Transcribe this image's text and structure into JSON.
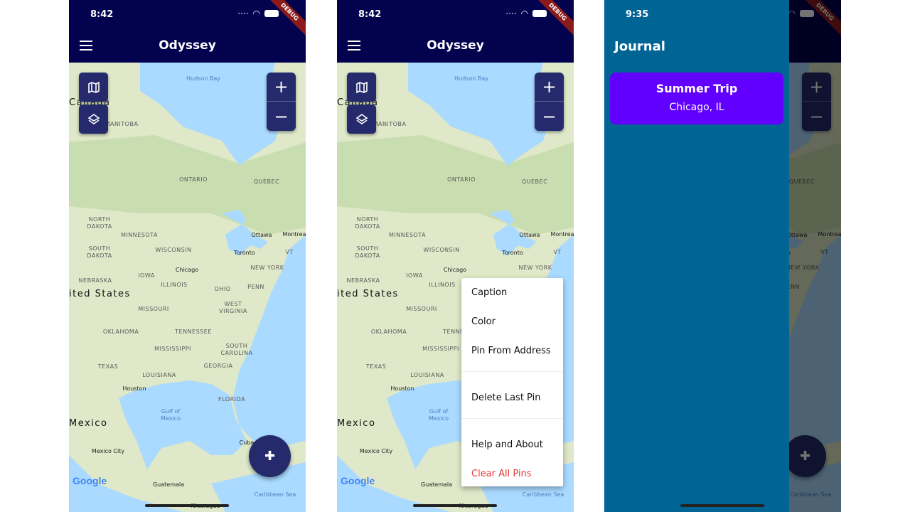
{
  "colors": {
    "appbar": "#02024f",
    "button": "#242a6b",
    "drawer": "#006494",
    "card": "#6200ff",
    "danger": "#e53935",
    "water": "#aadaff",
    "land": "#dfe8c8"
  },
  "screens": [
    {
      "time": "8:42",
      "title": "Odyssey",
      "debug": "DEBUG"
    },
    {
      "time": "8:42",
      "title": "Odyssey",
      "debug": "DEBUG"
    },
    {
      "time": "9:35",
      "debug": "DEBUG"
    }
  ],
  "icons": {
    "menu": "hamburger-icon",
    "map": "map-icon",
    "layers": "layers-icon",
    "zoom_in": "+",
    "zoom_out": "−",
    "pin": "📌"
  },
  "map": {
    "google_logo": "Google",
    "labels": [
      "Hudson Bay",
      "Canada",
      "MANITOBA",
      "ONTARIO",
      "QUEBEC",
      "NORTH\nDAKOTA",
      "MINNESOTA",
      "SOUTH\nDAKOTA",
      "WISCONSIN",
      "Ottawa",
      "Montrea",
      "Toronto",
      "VT",
      "NEBRASKA",
      "IOWA",
      "Chicago",
      "ILLINOIS",
      "OHIO",
      "NEW YORK",
      "PENN",
      "ited States",
      "MISSOURI",
      "WEST\nVIRGINIA",
      "OKLAHOMA",
      "TENNESSEE",
      "MISSISSIPPI",
      "SOUTH\nCAROLINA",
      "TEXAS",
      "GEORGIA",
      "LOUISIANA",
      "Houston",
      "FLORIDA",
      "Gulf of\nMexico",
      "Mexico",
      "Cuba",
      "Mexico City",
      "Guatemala",
      "Nicaragua",
      "Caribbean Sea"
    ]
  },
  "popup_menu": {
    "items": [
      "Caption",
      "Color",
      "Pin From Address",
      "Delete Last Pin",
      "Help and About",
      "Clear All Pins"
    ]
  },
  "drawer": {
    "title": "Journal",
    "entries": [
      {
        "title": "Summer Trip",
        "location": "Chicago, IL"
      }
    ]
  }
}
